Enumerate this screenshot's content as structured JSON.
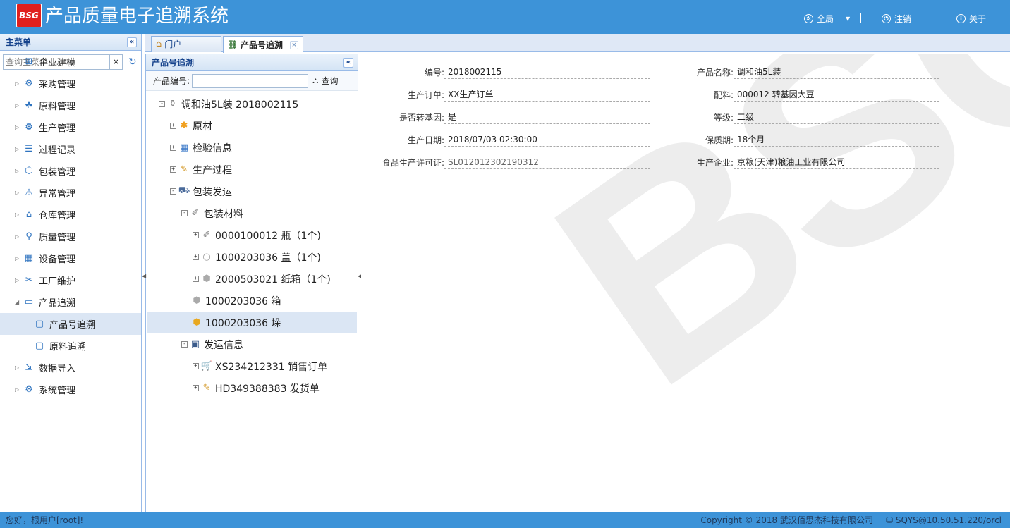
{
  "header": {
    "logo": "BSG",
    "title": "产品质量电子追溯系统",
    "global": "全局",
    "logout": "注销",
    "about": "关于"
  },
  "sidebar": {
    "title": "主菜单",
    "search_placeholder": "查询主菜单......",
    "items": [
      {
        "label": "企业建模",
        "icon": "plus-square-icon"
      },
      {
        "label": "采购管理",
        "icon": "gear-icon"
      },
      {
        "label": "原料管理",
        "icon": "users-icon"
      },
      {
        "label": "生产管理",
        "icon": "gears-icon"
      },
      {
        "label": "过程记录",
        "icon": "list-icon"
      },
      {
        "label": "包装管理",
        "icon": "box-icon"
      },
      {
        "label": "异常管理",
        "icon": "warning-icon"
      },
      {
        "label": "仓库管理",
        "icon": "warehouse-icon"
      },
      {
        "label": "质量管理",
        "icon": "magnifier-icon"
      },
      {
        "label": "设备管理",
        "icon": "device-icon"
      },
      {
        "label": "工厂维护",
        "icon": "tools-icon"
      },
      {
        "label": "产品追溯",
        "icon": "folder-icon"
      },
      {
        "label": "产品号追溯",
        "icon": "window-icon"
      },
      {
        "label": "原料追溯",
        "icon": "window-icon"
      },
      {
        "label": "数据导入",
        "icon": "import-icon"
      },
      {
        "label": "系统管理",
        "icon": "gear-icon"
      }
    ]
  },
  "tabs": [
    {
      "label": "门户"
    },
    {
      "label": "产品号追溯"
    }
  ],
  "trace_panel": {
    "title": "产品号追溯",
    "product_no_label": "产品编号:",
    "product_no_value": "",
    "query_label": "查询"
  },
  "tree": [
    {
      "label": "调和油5L装 2018002115",
      "icon": "bottle-icon"
    },
    {
      "label": "原材",
      "icon": "puzzle-icon"
    },
    {
      "label": "检验信息",
      "icon": "table-icon"
    },
    {
      "label": "生产过程",
      "icon": "edit-icon"
    },
    {
      "label": "包装发运",
      "icon": "truck-icon"
    },
    {
      "label": "包装材料",
      "icon": "clip-icon"
    },
    {
      "label": "0000100012 瓶（1个)",
      "icon": "clip-icon"
    },
    {
      "label": "1000203036 盖（1个)",
      "icon": "circle-icon"
    },
    {
      "label": "2000503021 纸箱（1个)",
      "icon": "cube-icon"
    },
    {
      "label": "1000203036 箱",
      "icon": "cube-icon"
    },
    {
      "label": "1000203036 垛",
      "icon": "cube-icon"
    },
    {
      "label": "发运信息",
      "icon": "monitor-icon"
    },
    {
      "label": "XS234212331 销售订单",
      "icon": "cart-icon"
    },
    {
      "label": "HD349388383 发货单",
      "icon": "note-icon"
    }
  ],
  "detail": {
    "left": [
      {
        "label": "编号:",
        "value": "2018002115"
      },
      {
        "label": "生产订单:",
        "value": "XX生产订单"
      },
      {
        "label": "是否转基因:",
        "value": "是"
      },
      {
        "label": "生产日期:",
        "value": "2018/07/03 02:30:00"
      },
      {
        "label": "食品生产许可证:",
        "value": "SL012012302190312"
      }
    ],
    "right": [
      {
        "label": "产品名称:",
        "value": "调和油5L装"
      },
      {
        "label": "配料:",
        "value": "000012 转基因大豆"
      },
      {
        "label": "等级:",
        "value": "二级"
      },
      {
        "label": "保质期:",
        "value": "18个月"
      },
      {
        "label": "生产企业:",
        "value": "京粮(天津)粮油工业有限公司"
      }
    ],
    "watermark": "BSG"
  },
  "footer": {
    "greeting": "您好，根用户[root]!",
    "copyright": "Copyright © 2018 武汉佰思杰科技有限公司",
    "db": "SQYS@10.50.51.220/orcl"
  },
  "colors": {
    "header": "#3d93d8",
    "logo": "#e0201e",
    "selected": "#dbe6f4"
  }
}
